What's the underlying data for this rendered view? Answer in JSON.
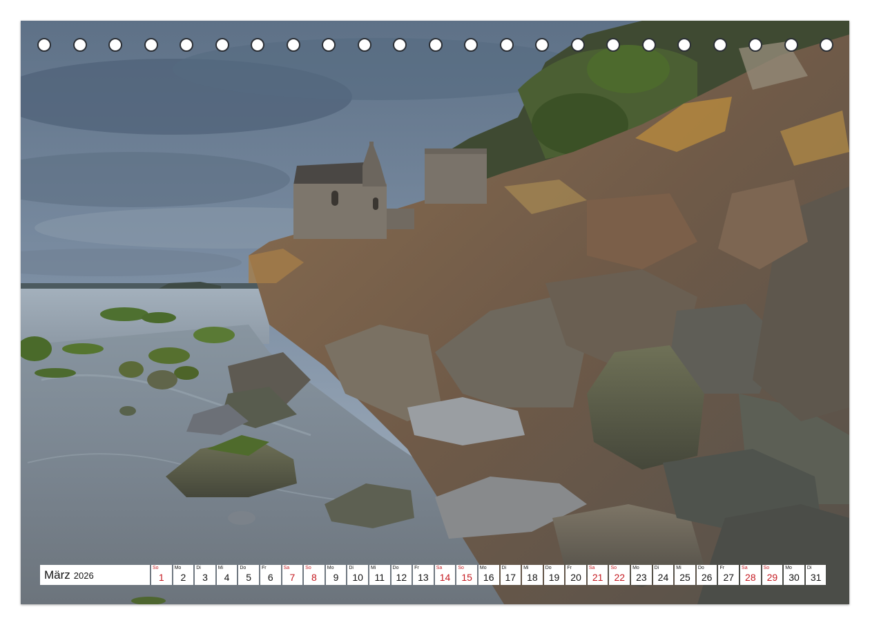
{
  "colors": {
    "weekend": "#c4181f",
    "text": "#111111",
    "ring": "#2b2f35"
  },
  "calendar": {
    "month": "März",
    "year": "2026",
    "days": [
      {
        "wd": "So",
        "d": "1",
        "we": true
      },
      {
        "wd": "Mo",
        "d": "2",
        "we": false
      },
      {
        "wd": "Di",
        "d": "3",
        "we": false
      },
      {
        "wd": "Mi",
        "d": "4",
        "we": false
      },
      {
        "wd": "Do",
        "d": "5",
        "we": false
      },
      {
        "wd": "Fr",
        "d": "6",
        "we": false
      },
      {
        "wd": "Sa",
        "d": "7",
        "we": true
      },
      {
        "wd": "So",
        "d": "8",
        "we": true
      },
      {
        "wd": "Mo",
        "d": "9",
        "we": false
      },
      {
        "wd": "Di",
        "d": "10",
        "we": false
      },
      {
        "wd": "Mi",
        "d": "11",
        "we": false
      },
      {
        "wd": "Do",
        "d": "12",
        "we": false
      },
      {
        "wd": "Fr",
        "d": "13",
        "we": false
      },
      {
        "wd": "Sa",
        "d": "14",
        "we": true
      },
      {
        "wd": "So",
        "d": "15",
        "we": true
      },
      {
        "wd": "Mo",
        "d": "16",
        "we": false
      },
      {
        "wd": "Di",
        "d": "17",
        "we": false
      },
      {
        "wd": "Mi",
        "d": "18",
        "we": false
      },
      {
        "wd": "Do",
        "d": "19",
        "we": false
      },
      {
        "wd": "Fr",
        "d": "20",
        "we": false
      },
      {
        "wd": "Sa",
        "d": "21",
        "we": true
      },
      {
        "wd": "So",
        "d": "22",
        "we": true
      },
      {
        "wd": "Mo",
        "d": "23",
        "we": false
      },
      {
        "wd": "Di",
        "d": "24",
        "we": false
      },
      {
        "wd": "Mi",
        "d": "25",
        "we": false
      },
      {
        "wd": "Do",
        "d": "26",
        "we": false
      },
      {
        "wd": "Fr",
        "d": "27",
        "we": false
      },
      {
        "wd": "Sa",
        "d": "28",
        "we": true
      },
      {
        "wd": "So",
        "d": "29",
        "we": true
      },
      {
        "wd": "Mo",
        "d": "30",
        "we": false
      },
      {
        "wd": "Di",
        "d": "31",
        "we": false
      }
    ]
  },
  "binding": {
    "ring_count": 23
  }
}
